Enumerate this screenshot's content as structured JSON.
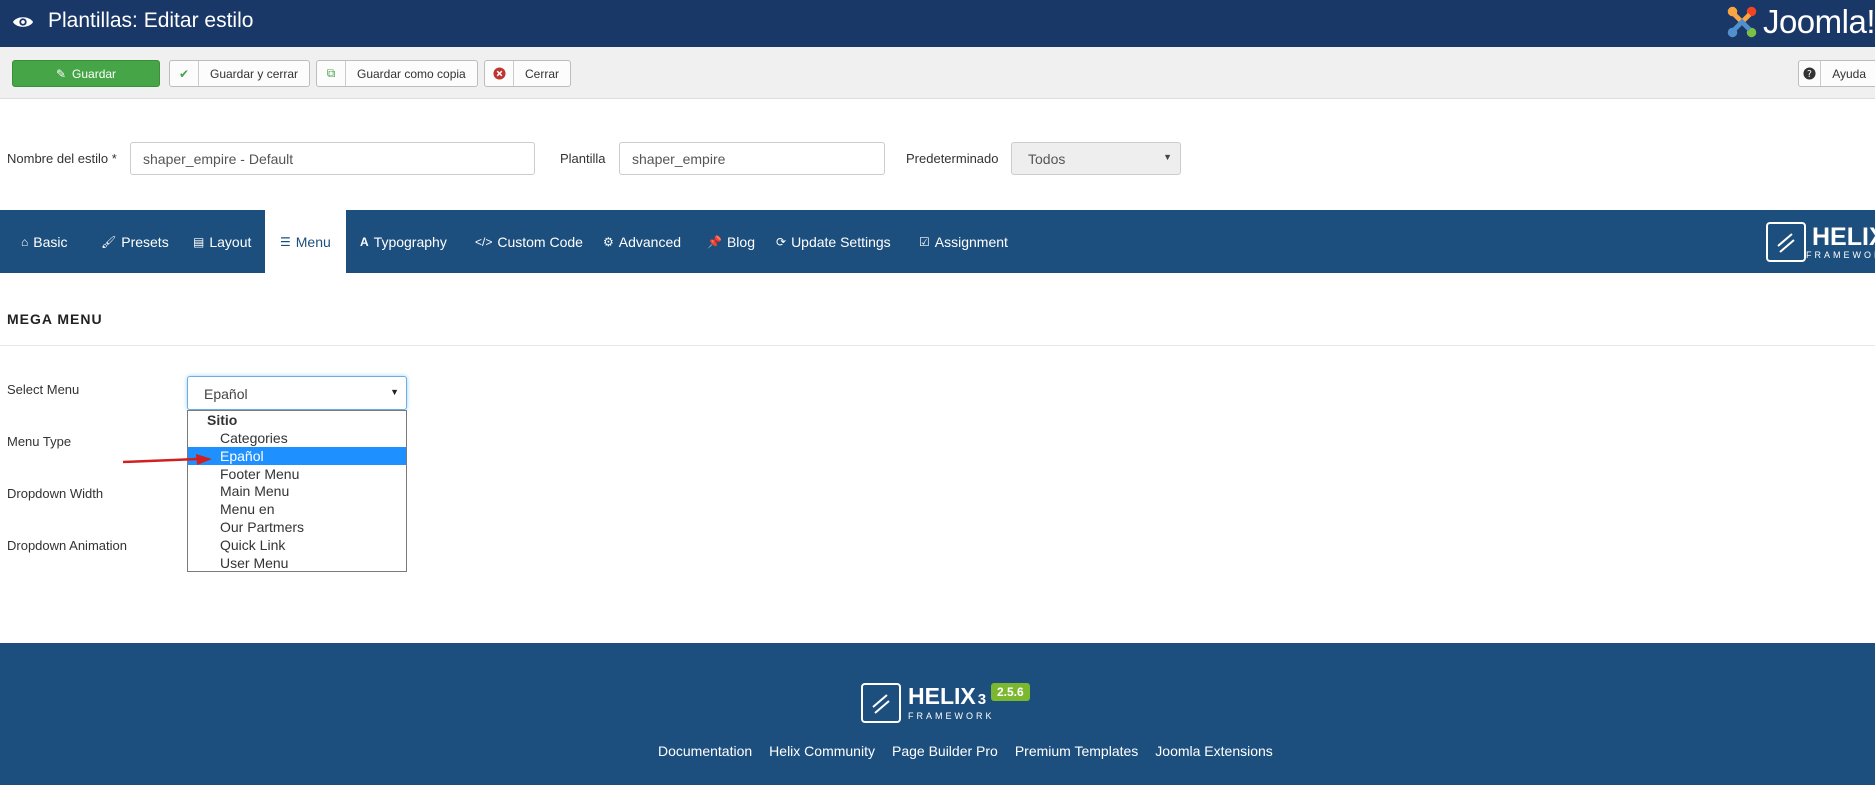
{
  "header": {
    "title": "Plantillas: Editar estilo",
    "brand": "Joomla!"
  },
  "toolbar": {
    "save": "Guardar",
    "save_close": "Guardar y cerrar",
    "save_copy": "Guardar como copia",
    "close": "Cerrar",
    "help": "Ayuda"
  },
  "form": {
    "style_name_label": "Nombre del estilo *",
    "style_name_value": "shaper_empire - Default",
    "template_label": "Plantilla",
    "template_value": "shaper_empire",
    "default_label": "Predeterminado",
    "default_value": "Todos"
  },
  "tabs": [
    {
      "label": "Basic",
      "icon": "home-icon"
    },
    {
      "label": "Presets",
      "icon": "brush-icon"
    },
    {
      "label": "Layout",
      "icon": "layout-icon"
    },
    {
      "label": "Menu",
      "icon": "list-icon"
    },
    {
      "label": "Typography",
      "icon": "font-icon"
    },
    {
      "label": "Custom Code",
      "icon": "code-icon"
    },
    {
      "label": "Advanced",
      "icon": "gear-icon"
    },
    {
      "label": "Blog",
      "icon": "pin-icon"
    },
    {
      "label": "Update Settings",
      "icon": "refresh-icon"
    },
    {
      "label": "Assignment",
      "icon": "checkbox-icon"
    }
  ],
  "helix": {
    "name": "HELIX",
    "sub": "FRAMEWORK",
    "footer_name": "HELIX",
    "footer_num": "3",
    "version": "2.5.6"
  },
  "section": {
    "title": "MEGA MENU",
    "select_menu_label": "Select Menu",
    "menu_type_label": "Menu Type",
    "dropdown_width_label": "Dropdown Width",
    "dropdown_animation_label": "Dropdown Animation",
    "select_menu_value": "Epañol"
  },
  "dropdown": {
    "group": "Sitio",
    "options": [
      "Categories",
      "Epañol",
      "Footer Menu",
      "Main Menu",
      "Menu en",
      "Our Partmers",
      "Quick Link",
      "User Menu"
    ],
    "selected": "Epañol"
  },
  "footer": {
    "links": [
      "Documentation",
      "Helix Community",
      "Page Builder Pro",
      "Premium Templates",
      "Joomla Extensions"
    ]
  },
  "colors": {
    "header_bg": "#1a3867",
    "nav_bg": "#1d4f7e",
    "save_green": "#46a546",
    "selection_blue": "#1e90ff",
    "version_green": "#7cb82f"
  }
}
